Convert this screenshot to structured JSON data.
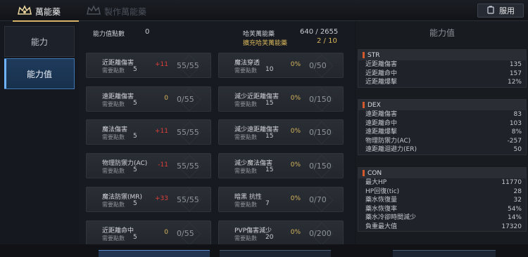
{
  "tabs": {
    "main": "萬能藥",
    "craft": "製作萬能藥"
  },
  "use_button": "服用",
  "sidebar": {
    "items": [
      {
        "label": "能力"
      },
      {
        "label": "能力值"
      }
    ]
  },
  "summary": {
    "points_label": "能力值點數",
    "points_value": "0",
    "elixir_label": "哈芙萬能藥",
    "elixir_value": "640 / 2655",
    "expand_label": "擴充哈芙萬能藥",
    "expand_value": "2 / 10"
  },
  "cards": [
    {
      "name": "近距離傷害",
      "req_label": "需要點數",
      "req": "5",
      "bonus": "+11",
      "progress": "55/55"
    },
    {
      "name": "魔法穿透",
      "req_label": "需要點數",
      "req": "10",
      "bonus": "0%",
      "progress": "0/50"
    },
    {
      "name": "遠距離傷害",
      "req_label": "需要點數",
      "req": "5",
      "bonus": "0",
      "progress": "0/55"
    },
    {
      "name": "減少近距離傷害",
      "req_label": "需要點數",
      "req": "15",
      "bonus": "0%",
      "progress": "0/150"
    },
    {
      "name": "魔法傷害",
      "req_label": "需要點數",
      "req": "5",
      "bonus": "+11",
      "progress": "55/55"
    },
    {
      "name": "減少遠距離傷害",
      "req_label": "需要點數",
      "req": "15",
      "bonus": "0%",
      "progress": "0/150"
    },
    {
      "name": "物理防禦力(AC)",
      "req_label": "需要點數",
      "req": "5",
      "bonus": "-11",
      "progress": "55/55"
    },
    {
      "name": "減少魔法傷害",
      "req_label": "需要點數",
      "req": "15",
      "bonus": "0%",
      "progress": "0/150"
    },
    {
      "name": "魔法防禦(MR)",
      "req_label": "需要點數",
      "req": "5",
      "bonus": "+33",
      "progress": "55/55"
    },
    {
      "name": "暗黑 抗性",
      "req_label": "需要點數",
      "req": "7",
      "bonus": "0%",
      "progress": "0/70"
    },
    {
      "name": "近距離命中",
      "req_label": "需要點數",
      "req": "5",
      "bonus": "0",
      "progress": "0/55"
    },
    {
      "name": "PVP傷害減少",
      "req_label": "需要點數",
      "req": "20",
      "bonus": "0%",
      "progress": "0/200"
    }
  ],
  "right": {
    "title": "能力值",
    "sections": [
      {
        "name": "STR",
        "stats": [
          {
            "label": "近距離傷害",
            "value": "135"
          },
          {
            "label": "近距離命中",
            "value": "157"
          },
          {
            "label": "近距離爆擊",
            "value": "12%"
          }
        ]
      },
      {
        "name": "DEX",
        "stats": [
          {
            "label": "遠距離傷害",
            "value": "83"
          },
          {
            "label": "遠距離命中",
            "value": "103"
          },
          {
            "label": "遠距離爆擊",
            "value": "8%"
          },
          {
            "label": "物理防禦力(AC)",
            "value": "-257"
          },
          {
            "label": "遠距離迴避力(ER)",
            "value": "50"
          }
        ]
      },
      {
        "name": "CON",
        "stats": [
          {
            "label": "最大HP",
            "value": "11770"
          },
          {
            "label": "HP回復(tic)",
            "value": "28"
          },
          {
            "label": "藥水恢復量",
            "value": "32"
          },
          {
            "label": "藥水恢復率",
            "value": "54%"
          },
          {
            "label": "藥水冷卻時間減少",
            "value": "14%"
          },
          {
            "label": "負重最大值",
            "value": "17320"
          }
        ]
      }
    ]
  }
}
